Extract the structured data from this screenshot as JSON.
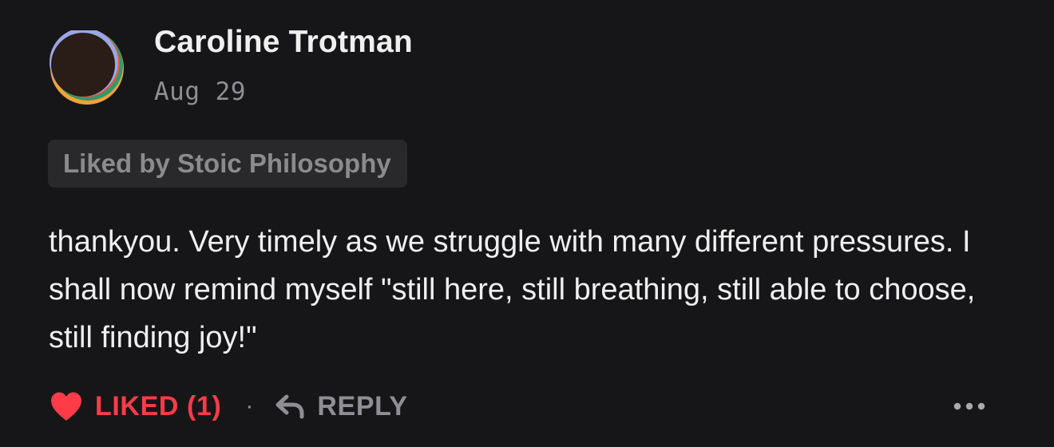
{
  "comment": {
    "author": "Caroline Trotman",
    "date": "Aug 29",
    "liked_by": "Liked by Stoic Philosophy",
    "text": "thankyou. Very timely as we struggle with many different pressures. I shall now remind myself \"still here, still breathing, still able to choose, still finding joy!\"",
    "avatar_icon": "avatar-image"
  },
  "actions": {
    "liked_label": "LIKED (1)",
    "separator": "·",
    "reply_label": "REPLY",
    "heart_icon": "heart-icon",
    "reply_icon": "reply-arrow-icon",
    "more_icon": "more-dots-icon"
  },
  "colors": {
    "background": "#161618",
    "liked": "#ff3b48",
    "muted": "#8e8e93",
    "text": "#efefef",
    "liked_by_bg": "#29292b"
  }
}
